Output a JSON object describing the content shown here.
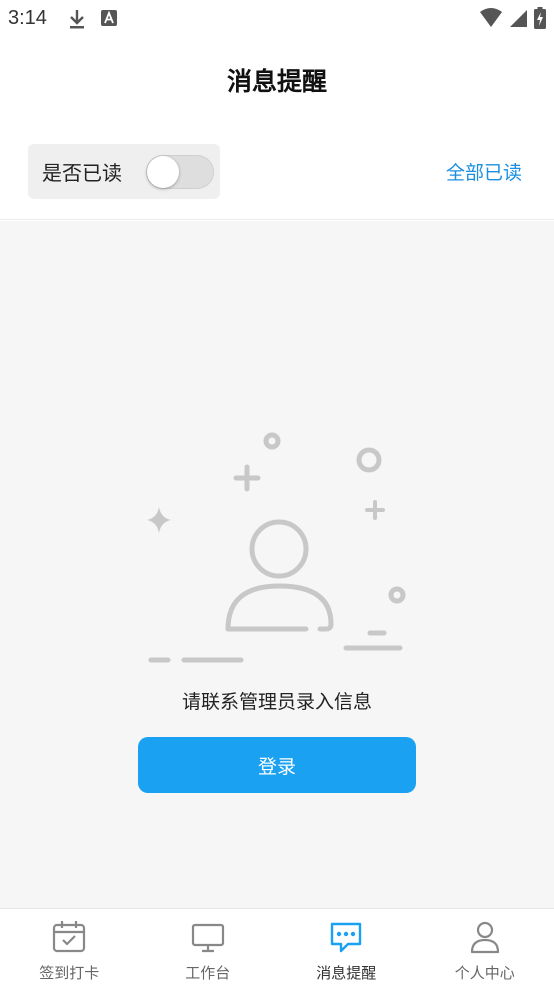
{
  "status_bar": {
    "time": "3:14"
  },
  "header": {
    "title": "消息提醒"
  },
  "filter": {
    "read_label": "是否已读",
    "read_toggle_on": false,
    "mark_all_read": "全部已读"
  },
  "empty_state": {
    "message": "请联系管理员录入信息",
    "login_label": "登录"
  },
  "bottom_nav": {
    "items": [
      {
        "label": "签到打卡",
        "icon": "calendar-check-icon"
      },
      {
        "label": "工作台",
        "icon": "monitor-icon"
      },
      {
        "label": "消息提醒",
        "icon": "chat-bubble-icon",
        "active": true
      },
      {
        "label": "个人中心",
        "icon": "person-icon"
      }
    ]
  },
  "colors": {
    "accent": "#1ba1f1",
    "link": "#1a8fe0",
    "background": "#f6f6f7"
  }
}
